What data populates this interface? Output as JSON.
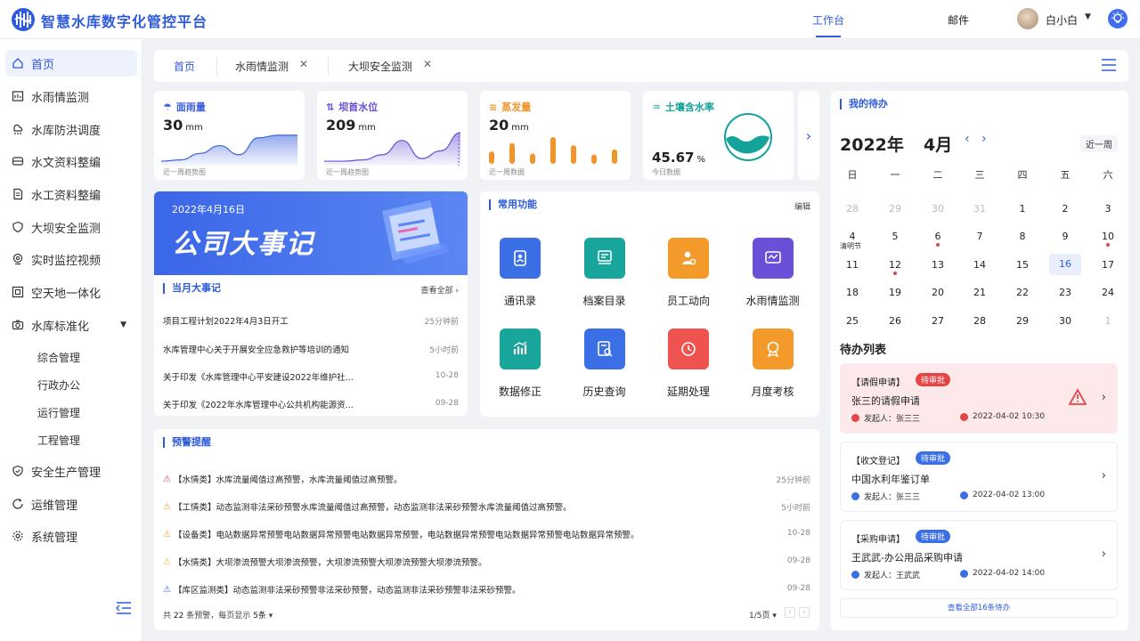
{
  "header": {
    "title": "智慧水库数字化管控平台",
    "nav": [
      "工作台",
      "邮件"
    ],
    "user": "白小白"
  },
  "sidebar": {
    "items": [
      "首页",
      "水雨情监测",
      "水库防洪调度",
      "水文资料整编",
      "水工资料整编",
      "大坝安全监测",
      "实时监控视频",
      "空天地一体化",
      "水库标准化"
    ],
    "sub": [
      "综合管理",
      "行政办公",
      "运行管理",
      "工程管理"
    ],
    "items2": [
      "安全生产管理",
      "运维管理",
      "系统管理"
    ]
  },
  "tabs": [
    "首页",
    "水雨情监测",
    "大坝安全监测"
  ],
  "kpis": [
    {
      "title": "面雨量",
      "value": "30",
      "unit": "mm",
      "note": "近一周趋势图",
      "color": "#3e63dd",
      "icon": "rain-icon"
    },
    {
      "title": "坝首水位",
      "value": "209",
      "unit": "mm",
      "note": "近一周趋势图",
      "color": "#6a4fd8",
      "icon": "water-level-icon"
    },
    {
      "title": "蒸发量",
      "value": "20",
      "unit": "mm",
      "note": "近一周数据",
      "color": "#f0952a",
      "icon": "evaporation-icon"
    },
    {
      "title": "土壤含水率",
      "value": "45.67",
      "unit": "%",
      "note": "今日数据",
      "color": "#14a39a",
      "icon": "soil-icon"
    }
  ],
  "chart_data": [
    {
      "type": "area",
      "series": [
        {
          "values": [
            2,
            3,
            8,
            14,
            7,
            20,
            22,
            22
          ]
        }
      ]
    },
    {
      "type": "area",
      "series": [
        {
          "values": [
            2,
            2,
            3,
            7,
            18,
            4,
            10,
            24
          ]
        }
      ]
    },
    {
      "type": "bar",
      "values": [
        12,
        20,
        10,
        26,
        18,
        9,
        14
      ]
    },
    {
      "type": "gauge",
      "value": 45.67
    }
  ],
  "banner": {
    "date": "2022年4月16日",
    "title": "公司大事记"
  },
  "events": {
    "title": "当月大事记",
    "more": "查看全部 ›",
    "rows": [
      {
        "text": "项目工程计划2022年4月3日开工",
        "time": "25分钟前"
      },
      {
        "text": "水库管理中心关于开展安全应急救护等培训的通知",
        "time": "5小时前"
      },
      {
        "text": "关于印发《水库管理中心平安建设2022年维护社...",
        "time": "10-28"
      },
      {
        "text": "关于印发《2022年水库管理中心公共机构能源资...",
        "time": "09-28"
      }
    ]
  },
  "functions": {
    "title": "常用功能",
    "edit": "编辑",
    "items": [
      {
        "label": "通讯录",
        "color": "#3b6fe6",
        "icon": "contacts-icon"
      },
      {
        "label": "档案目录",
        "color": "#17a59c",
        "icon": "archive-icon"
      },
      {
        "label": "员工动向",
        "color": "#f39a2b",
        "icon": "staff-icon"
      },
      {
        "label": "水雨情监测",
        "color": "#6a4fd8",
        "icon": "monitor-icon"
      },
      {
        "label": "数据修正",
        "color": "#17a59c",
        "icon": "chart-icon"
      },
      {
        "label": "历史查询",
        "color": "#3b6fe6",
        "icon": "history-icon"
      },
      {
        "label": "延期处理",
        "color": "#ef5350",
        "icon": "clock-icon"
      },
      {
        "label": "月度考核",
        "color": "#f39a2b",
        "icon": "medal-icon"
      }
    ]
  },
  "warnings": {
    "title": "预警提醒",
    "rows": [
      {
        "type": "【水情类】",
        "text": "水库流量阈值过高预警，水库流量阈值过高预警。",
        "time": "25分钟前",
        "color": "#e54545"
      },
      {
        "type": "【工情类】",
        "text": "动态监测非法采砂预警水库流量阈值过高预警，动态监测非法采砂预警水库流量阈值过高预警。",
        "time": "5小时前",
        "color": "#f39a2b"
      },
      {
        "type": "【设备类】",
        "text": "电站数据异常预警电站数据异常预警电站数据异常预警，电站数据异常预警电站数据异常预警电站数据异常预警。",
        "time": "10-28",
        "color": "#f39a2b"
      },
      {
        "type": "【水情类】",
        "text": "大坝渗流预警大坝渗流预警，大坝渗流预警大坝渗流预警大坝渗流预警。",
        "time": "09-28",
        "color": "#f2c12e"
      },
      {
        "type": "【库区监测类】",
        "text": "动态监测非法采砂预警非法采砂预警，动态监测非法采砂预警非法采砂预警。",
        "time": "09-28",
        "color": "#3b6fe6"
      }
    ],
    "footer_pre": "共",
    "footer_count": "22",
    "footer_mid": "条预警，每页显示",
    "footer_size": "5条",
    "footer_page": "1/5页"
  },
  "calendar": {
    "title": "我的待办",
    "year": "2022年",
    "month": "4月",
    "btn": "近一周",
    "weekdays": [
      "日",
      "一",
      "二",
      "三",
      "四",
      "五",
      "六"
    ],
    "days": [
      [
        "28",
        "29",
        "30",
        "31",
        "1",
        "2",
        "3"
      ],
      [
        "4",
        "5",
        "6",
        "7",
        "8",
        "9",
        "10"
      ],
      [
        "11",
        "12",
        "13",
        "14",
        "15",
        "16",
        "17"
      ],
      [
        "18",
        "19",
        "20",
        "21",
        "22",
        "23",
        "24"
      ],
      [
        "25",
        "26",
        "27",
        "28",
        "29",
        "30",
        "1"
      ]
    ],
    "holiday": "清明节"
  },
  "todo": {
    "title": "待办列表",
    "items": [
      {
        "cat": "【请假申请】",
        "badge": "待审批",
        "title": "张三的请假申请",
        "person": "发起人：张三三",
        "date": "2022-04-02  10:30"
      },
      {
        "cat": "【收文登记】",
        "badge": "待审批",
        "title": "中国水利年鉴订单",
        "person": "发起人：张三三",
        "date": "2022-04-02  13:00"
      },
      {
        "cat": "【采购申请】",
        "badge": "待审批",
        "title": "王武武-办公用品采购申请",
        "person": "发起人：王武武",
        "date": "2022-04-02  14:00"
      }
    ],
    "more": "查看全部16条待办"
  }
}
